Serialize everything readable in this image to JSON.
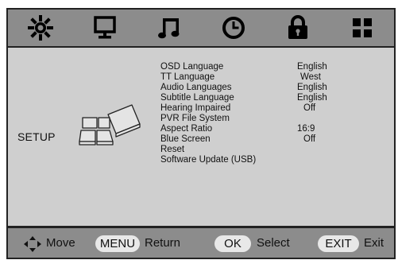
{
  "tabs": [
    {
      "id": "picture",
      "icon": "sun-icon"
    },
    {
      "id": "monitor",
      "icon": "monitor-icon"
    },
    {
      "id": "audio",
      "icon": "music-note-icon"
    },
    {
      "id": "time",
      "icon": "clock-icon"
    },
    {
      "id": "lock",
      "icon": "lock-icon"
    },
    {
      "id": "setup",
      "icon": "grid-icon"
    }
  ],
  "section": {
    "title": "SETUP",
    "icon": "setup-blocks-icon"
  },
  "menu": {
    "items": [
      {
        "label": "OSD Language",
        "value": "English"
      },
      {
        "label": "TT Language",
        "value": "West"
      },
      {
        "label": "Audio Languages",
        "value": "English"
      },
      {
        "label": "Subtitle Language",
        "value": "English"
      },
      {
        "label": "Hearing Impaired",
        "value": "Off"
      },
      {
        "label": "PVR File System",
        "value": ""
      },
      {
        "label": "Aspect Ratio",
        "value": "16:9"
      },
      {
        "label": "Blue Screen",
        "value": "Off"
      },
      {
        "label": "Reset",
        "value": ""
      },
      {
        "label": "Software Update (USB)",
        "value": ""
      }
    ]
  },
  "hints": {
    "move_label": "Move",
    "menu_key": "MENU",
    "menu_label": "Return",
    "ok_key": "OK",
    "ok_label": "Select",
    "exit_key": "EXIT",
    "exit_label": "Exit",
    "move_icon": "four-way-arrow-icon"
  },
  "colors": {
    "bar_background": "#8c8c8c",
    "panel_background": "#cfcfcf",
    "key_background": "#e8e8e8",
    "border": "#222222"
  }
}
